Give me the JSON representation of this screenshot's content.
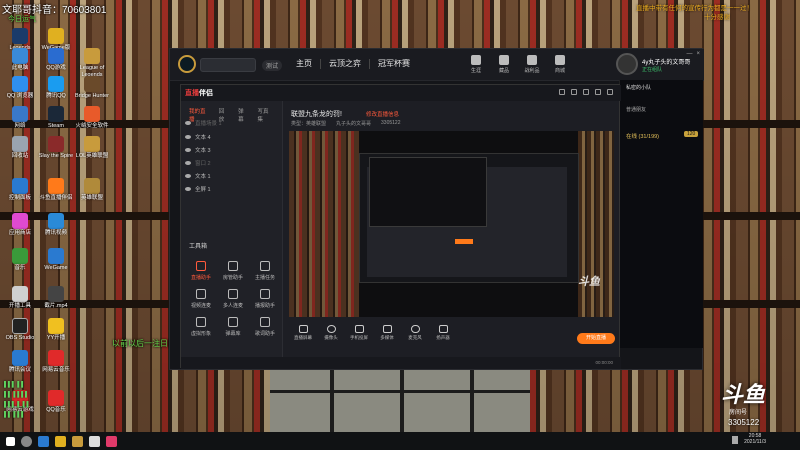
{
  "overlay": {
    "top_left_text": "文耶哥抖音：70603801",
    "sub_left_text": "今日运气",
    "top_right_text": "直播中带有任何的宣传行为都是一一过！",
    "top_right_sub": "十分感谢",
    "mid_left_text": "以前以后一注日口",
    "colors": {
      "accent_orange": "#ff7a1a",
      "live_red": "#ff5a3c",
      "green": "#64d84b"
    }
  },
  "desktop_icons": [
    {
      "label": "Legends",
      "icon": "league-icon"
    },
    {
      "label": "WeGame版",
      "icon": "wegame-icon"
    },
    {
      "label": "此电脑",
      "icon": "computer-icon"
    },
    {
      "label": "QQ游戏",
      "icon": "qq-game-icon"
    },
    {
      "label": "League of Legends",
      "icon": "league-icon"
    },
    {
      "label": "QQ 浏览器",
      "icon": "qq-browser-icon"
    },
    {
      "label": "腾讯QQ",
      "icon": "qq-icon"
    },
    {
      "label": "Bridge Hunter",
      "icon": "game-icon"
    },
    {
      "label": "网络",
      "icon": "network-icon"
    },
    {
      "label": "Steam",
      "icon": "steam-icon"
    },
    {
      "label": "火绒安全软件",
      "icon": "shield-icon"
    },
    {
      "label": "回收站",
      "icon": "recycle-bin-icon"
    },
    {
      "label": "Slay the Spire",
      "icon": "game-icon"
    },
    {
      "label": "LOL英雄联盟",
      "icon": "league-icon"
    },
    {
      "label": "控制面板",
      "icon": "control-panel-icon"
    },
    {
      "label": "斗鱼直播伴侣",
      "icon": "douyu-icon"
    },
    {
      "label": "英雄联盟",
      "icon": "league-icon"
    },
    {
      "label": "应用商店",
      "icon": "store-icon"
    },
    {
      "label": "腾讯视频",
      "icon": "video-icon"
    },
    {
      "label": "WeGame",
      "icon": "wegame-icon"
    },
    {
      "label": "音乐",
      "icon": "music-icon"
    },
    {
      "label": "网易云",
      "icon": "netease-icon"
    },
    {
      "label": "开播工具",
      "icon": "broadcast-icon"
    },
    {
      "label": "截片.mp4",
      "icon": "video-file-icon"
    },
    {
      "label": "OBS Studio",
      "icon": "obs-icon"
    },
    {
      "label": "YY开播",
      "icon": "yy-icon"
    },
    {
      "label": "网易云音乐",
      "icon": "netease-icon"
    },
    {
      "label": "腾讯会议",
      "icon": "meeting-icon"
    },
    {
      "label": "网易云游戏",
      "icon": "cloud-game-icon"
    },
    {
      "label": "QQ音乐",
      "icon": "qq-music-icon"
    }
  ],
  "client": {
    "version": "测试",
    "nav": [
      "主页",
      "云顶之弈",
      "冠军杯赛"
    ],
    "top_buttons": [
      "生涯",
      "藏品",
      "战利品",
      "商城"
    ],
    "profile_name": "4y丸子头的文哥哥",
    "profile_status": "正在组队",
    "window_controls": [
      "—",
      "×"
    ],
    "friends": {
      "title": "私密的小队",
      "group": "普通朋友",
      "online_label": "在线 (31/199)",
      "badge": "120"
    }
  },
  "stream": {
    "app_name_red": "直播",
    "app_name_rest": "伴侣",
    "tabs": [
      "我的直播",
      "回放",
      "弹幕",
      "写真集"
    ],
    "scenes": [
      {
        "label": "直播场景 1",
        "dim": true
      },
      {
        "label": "文本 4",
        "dim": false
      },
      {
        "label": "文本 3",
        "dim": false
      },
      {
        "label": "窗口 2",
        "dim": true
      },
      {
        "label": "文本 1",
        "dim": false
      },
      {
        "label": "全屏 1",
        "dim": false
      }
    ],
    "tool_title": "工具箱",
    "tools": [
      {
        "label": "直播助手",
        "red": true
      },
      {
        "label": "房管助手",
        "red": false
      },
      {
        "label": "主播任务",
        "red": false
      },
      {
        "label": "视频连麦",
        "red": false
      },
      {
        "label": "多人连麦",
        "red": false
      },
      {
        "label": "播报助手",
        "red": false
      },
      {
        "label": "虚拟形象",
        "red": false
      },
      {
        "label": "弹幕库",
        "red": false
      },
      {
        "label": "歌词助手",
        "red": false
      }
    ],
    "title": "联盟九条龙的罚!",
    "tag": "修改直播信息",
    "info": [
      "类型：英雄联盟",
      "丸子头的文哥哥",
      "3305122"
    ],
    "bottom_items": [
      "直播屏幕",
      "摄像头",
      "手机投屏",
      "多媒体",
      "麦克风",
      "扬声器"
    ],
    "start_label": "开始直播",
    "status_time": "00:00:00"
  },
  "taskbar": {
    "clock_time": "20:58",
    "clock_date": "2021/11/3"
  },
  "brand": {
    "room_no": "3305122",
    "logo_sub": "房间号"
  }
}
